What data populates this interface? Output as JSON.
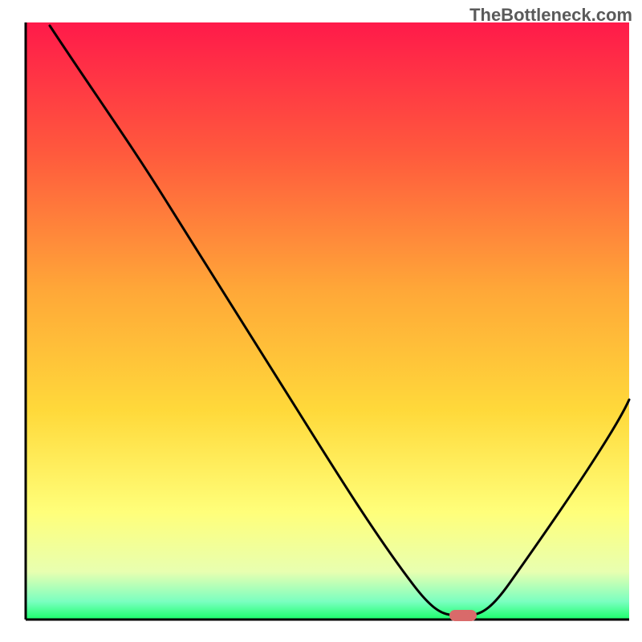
{
  "watermark": "TheBottleneck.com",
  "chart_data": {
    "type": "line",
    "xlim": [
      0,
      100
    ],
    "ylim": [
      0,
      100
    ],
    "background_gradient": {
      "top": "#ff1a4a",
      "mid_upper": "#ff8c3a",
      "mid": "#ffd93a",
      "mid_lower": "#ffff7a",
      "bottom": "#1aff6a"
    },
    "curve": {
      "description": "V-shaped bottleneck curve — high on left, descends to a trough near x≈72, rises again on right",
      "points": [
        {
          "x": 4,
          "y": 99
        },
        {
          "x": 18,
          "y": 80
        },
        {
          "x": 25,
          "y": 70
        },
        {
          "x": 35,
          "y": 54
        },
        {
          "x": 45,
          "y": 38
        },
        {
          "x": 55,
          "y": 22
        },
        {
          "x": 63,
          "y": 8
        },
        {
          "x": 67,
          "y": 2
        },
        {
          "x": 70,
          "y": 1
        },
        {
          "x": 74,
          "y": 1
        },
        {
          "x": 77,
          "y": 2
        },
        {
          "x": 82,
          "y": 10
        },
        {
          "x": 88,
          "y": 20
        },
        {
          "x": 94,
          "y": 30
        },
        {
          "x": 98,
          "y": 37
        }
      ]
    },
    "marker": {
      "x": 72,
      "y": 1,
      "color": "#d96a6a",
      "shape": "rounded-pill"
    },
    "axes": {
      "color": "#000000",
      "left": true,
      "bottom": true
    }
  }
}
